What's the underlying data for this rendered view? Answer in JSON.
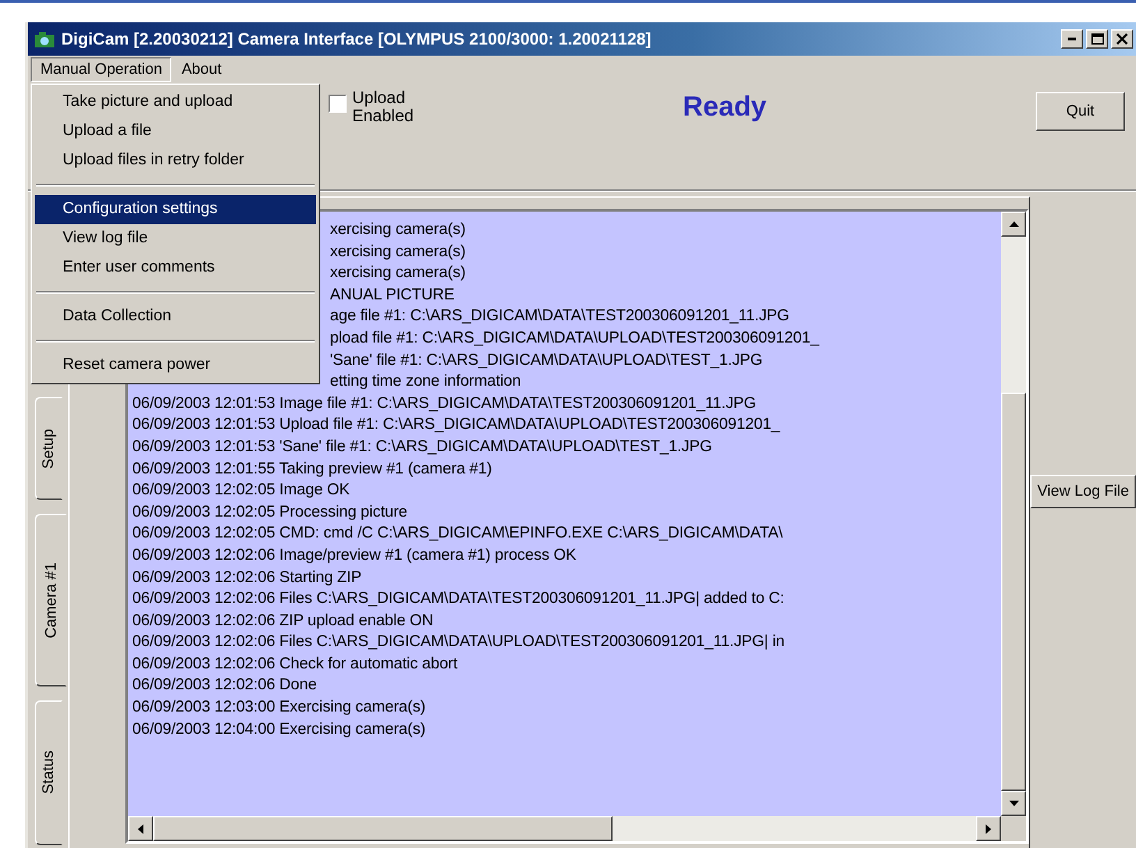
{
  "window": {
    "title": "DigiCam [2.20030212]  Camera Interface [OLYMPUS 2100/3000: 1.20021128]"
  },
  "menu_bar": [
    {
      "label": "Manual Operation",
      "selected": true
    },
    {
      "label": "About",
      "selected": false
    }
  ],
  "menu": {
    "groups": [
      [
        {
          "label": "Take picture and upload",
          "selected": false
        },
        {
          "label": "Upload a file",
          "selected": false
        },
        {
          "label": "Upload files in retry folder",
          "selected": false
        }
      ],
      [
        {
          "label": "Configuration settings",
          "selected": true
        },
        {
          "label": "View log file",
          "selected": false
        },
        {
          "label": "Enter user comments",
          "selected": false
        }
      ],
      [
        {
          "label": "Data Collection",
          "selected": false
        }
      ],
      [
        {
          "label": "Reset camera power",
          "selected": false
        }
      ]
    ]
  },
  "upload_checkbox": {
    "label_lines": [
      "Upload",
      "Enabled"
    ],
    "checked": false
  },
  "status_text": "Ready",
  "quit_button": "Quit",
  "tabs": [
    {
      "label": "Setup",
      "selected": false
    },
    {
      "label": "Camera #1",
      "selected": true
    },
    {
      "label": "Status",
      "selected": false
    }
  ],
  "log": {
    "partly_covered_lines": [
      "xercising camera(s)",
      "xercising camera(s)",
      "xercising camera(s)",
      "ANUAL PICTURE",
      "age file #1: C:\\ARS_DIGICAM\\DATA\\TEST200306091201_11.JPG",
      "pload file #1: C:\\ARS_DIGICAM\\DATA\\UPLOAD\\TEST200306091201_",
      "'Sane' file #1: C:\\ARS_DIGICAM\\DATA\\UPLOAD\\TEST_1.JPG",
      "etting time zone information"
    ],
    "lines": [
      "06/09/2003 12:01:53 Image file #1: C:\\ARS_DIGICAM\\DATA\\TEST200306091201_11.JPG",
      "06/09/2003 12:01:53 Upload file #1: C:\\ARS_DIGICAM\\DATA\\UPLOAD\\TEST200306091201_",
      "06/09/2003 12:01:53 'Sane' file #1: C:\\ARS_DIGICAM\\DATA\\UPLOAD\\TEST_1.JPG",
      "06/09/2003 12:01:55 Taking preview #1 (camera #1)",
      "06/09/2003 12:02:05 Image OK",
      "06/09/2003 12:02:05 Processing picture",
      "06/09/2003 12:02:05 CMD: cmd /C C:\\ARS_DIGICAM\\EPINFO.EXE C:\\ARS_DIGICAM\\DATA\\",
      "06/09/2003 12:02:06 Image/preview #1 (camera #1) process OK",
      "06/09/2003 12:02:06 Starting ZIP",
      "06/09/2003 12:02:06 Files C:\\ARS_DIGICAM\\DATA\\TEST200306091201_11.JPG| added to C:",
      "06/09/2003 12:02:06 ZIP upload enable ON",
      "06/09/2003 12:02:06 Files C:\\ARS_DIGICAM\\DATA\\UPLOAD\\TEST200306091201_11.JPG| in",
      "06/09/2003 12:02:06 Check for automatic abort",
      "06/09/2003 12:02:06 Done",
      "06/09/2003 12:03:00 Exercising camera(s)",
      "06/09/2003 12:04:00 Exercising camera(s)"
    ]
  },
  "view_log_button": "View Log File"
}
